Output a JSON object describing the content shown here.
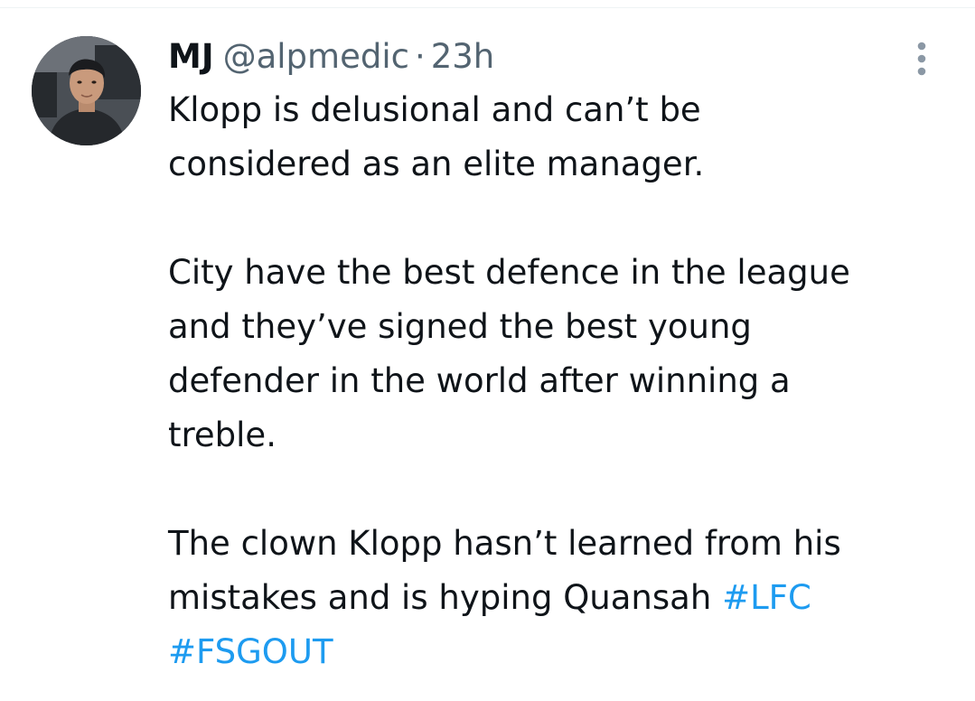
{
  "tweet": {
    "author": {
      "display_name": "MJ",
      "handle": "@alpmedic",
      "avatar_icon": "user-photo-avatar"
    },
    "separator": "·",
    "timestamp": "23h",
    "more_icon": "vertical-ellipsis-icon",
    "paragraphs": [
      {
        "text": "Klopp is delusional and can’t be\nconsidered as an elite manager."
      },
      {
        "text": "City have the best defence in the league\nand they’ve signed the best young\ndefender in the world after winning a\ntreble."
      },
      {
        "text": "The clown Klopp hasn’t learned from his\nmistakes and is hyping Quansah ",
        "hashtags": [
          "#LFC",
          "#FSGOUT"
        ]
      }
    ]
  },
  "colors": {
    "text": "#0f1419",
    "secondary": "#536471",
    "link": "#1d9bf0",
    "divider": "#eff3f4",
    "background": "#ffffff"
  }
}
